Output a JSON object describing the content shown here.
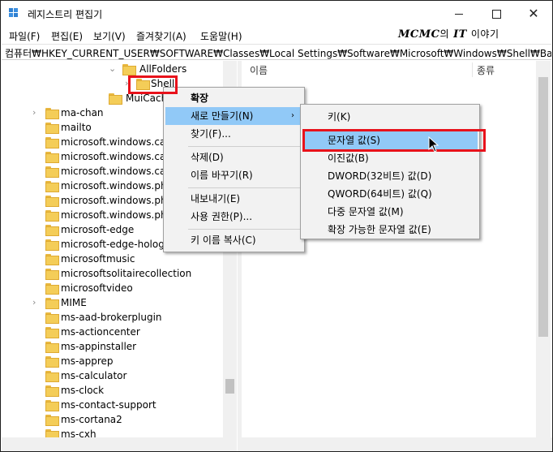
{
  "window": {
    "title": "레지스트리 편집기",
    "minimize_glyph": "",
    "maximize_glyph": "",
    "close_glyph": "✕"
  },
  "menubar": {
    "items": [
      "파일(F)",
      "편집(E)",
      "보기(V)",
      "즐겨찾기(A)",
      "도움말(H)"
    ],
    "watermark_a": "MCMC",
    "watermark_b": "의",
    "watermark_c": "IT",
    "watermark_d": "이야기"
  },
  "address": {
    "path": "컴퓨터₩HKEY_CURRENT_USER₩SOFTWARE₩Classes₩Local Settings₩Software₩Microsoft₩Windows₩Shell₩Bags₩AllFolders₩"
  },
  "tree": {
    "items": [
      {
        "label": "AllFolders",
        "expander": "⌄"
      },
      {
        "label": "Shell",
        "expander": "›"
      },
      {
        "label": "MuiCache",
        "expander": ""
      },
      {
        "label": "ma-chan",
        "expander": "›"
      },
      {
        "label": "mailto",
        "expander": ""
      },
      {
        "label": "microsoft.windows.camera",
        "expander": ""
      },
      {
        "label": "microsoft.windows.camera",
        "expander": ""
      },
      {
        "label": "microsoft.windows.camera",
        "expander": ""
      },
      {
        "label": "microsoft.windows.photos",
        "expander": ""
      },
      {
        "label": "microsoft.windows.photos",
        "expander": ""
      },
      {
        "label": "microsoft.windows.photos",
        "expander": ""
      },
      {
        "label": "microsoft-edge",
        "expander": ""
      },
      {
        "label": "microsoft-edge-holographic",
        "expander": ""
      },
      {
        "label": "microsoftmusic",
        "expander": ""
      },
      {
        "label": "microsoftsolitairecollection",
        "expander": ""
      },
      {
        "label": "microsoftvideo",
        "expander": ""
      },
      {
        "label": "MIME",
        "expander": "›"
      },
      {
        "label": "ms-aad-brokerplugin",
        "expander": ""
      },
      {
        "label": "ms-actioncenter",
        "expander": ""
      },
      {
        "label": "ms-appinstaller",
        "expander": ""
      },
      {
        "label": "ms-apprep",
        "expander": ""
      },
      {
        "label": "ms-calculator",
        "expander": ""
      },
      {
        "label": "ms-clock",
        "expander": ""
      },
      {
        "label": "ms-contact-support",
        "expander": ""
      },
      {
        "label": "ms-cortana2",
        "expander": ""
      },
      {
        "label": "ms-cxh",
        "expander": ""
      }
    ]
  },
  "list": {
    "col_name": "이름",
    "col_type": "종류"
  },
  "context_menu": {
    "items": [
      "확장",
      "새로 만들기(N)",
      "찾기(F)...",
      "삭제(D)",
      "이름 바꾸기(R)",
      "내보내기(E)",
      "사용 권한(P)...",
      "키 이름 복사(C)"
    ],
    "submenu_arrow": "›"
  },
  "submenu": {
    "items": [
      "키(K)",
      "문자열 값(S)",
      "이진값(B)",
      "DWORD(32비트) 값(D)",
      "QWORD(64비트) 값(Q)",
      "다중 문자열 값(M)",
      "확장 가능한 문자열 값(E)"
    ]
  },
  "colors": {
    "hover": "#91c9f7",
    "highlight": "#e8121b",
    "folder": "#f4cd58"
  }
}
